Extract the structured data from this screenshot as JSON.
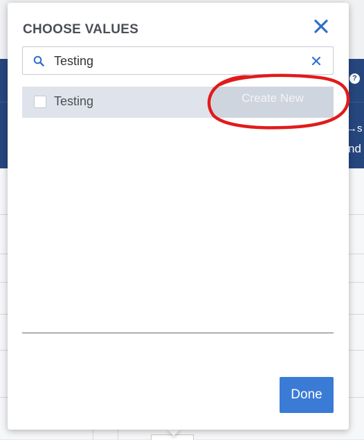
{
  "dialog": {
    "title": "CHOOSE VALUES",
    "close_icon": "close-icon",
    "search": {
      "value": "Testing",
      "icon": "search-icon",
      "clear_icon": "clear-icon"
    },
    "results": [
      {
        "label": "Testing",
        "checked": false
      }
    ],
    "create_new_label": "Create New",
    "done_label": "Done"
  },
  "colors": {
    "accent": "#3a7bd5",
    "header_band": "#26467e",
    "annotation": "#e11b1b"
  },
  "background": {
    "help_icon": "help-icon",
    "help_glyph": "?",
    "fragment_1": "→s",
    "fragment_2": "nd"
  }
}
